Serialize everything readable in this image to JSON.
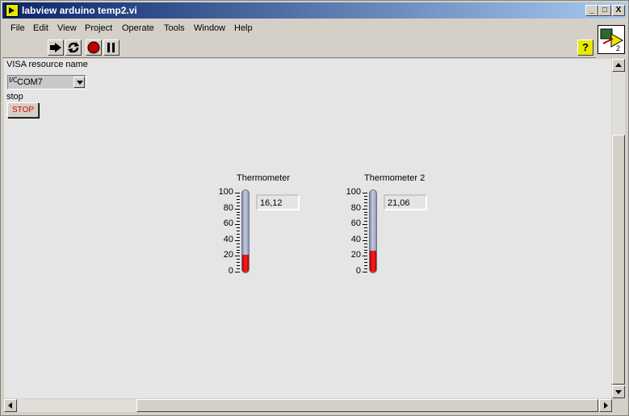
{
  "window": {
    "title": "labview arduino temp2.vi",
    "controls": [
      "_",
      "□",
      "X"
    ]
  },
  "menu": [
    "File",
    "Edit",
    "View",
    "Project",
    "Operate",
    "Tools",
    "Window",
    "Help"
  ],
  "toolbar": {
    "buttons": [
      "run-icon",
      "run-continuously-icon",
      "abort-icon",
      "pause-icon"
    ],
    "help_label": "?",
    "vi_icon_number": "2"
  },
  "panel": {
    "visa_label": "VISA resource name",
    "visa_io_glyph": "I/O",
    "visa_value": "COM7",
    "stop_label": "stop",
    "stop_button_text": "STOP"
  },
  "thermometers": [
    {
      "label": "Thermometer",
      "readout": "16,12",
      "value": 16.12,
      "scale": [
        "100",
        "80",
        "60",
        "40",
        "20",
        "0"
      ],
      "range": [
        0,
        100
      ]
    },
    {
      "label": "Thermometer 2",
      "readout": "21,06",
      "value": 21.06,
      "scale": [
        "100",
        "80",
        "60",
        "40",
        "20",
        "0"
      ],
      "range": [
        0,
        100
      ]
    }
  ],
  "colors": {
    "fill": "#ff2020",
    "stop_text": "#e00000",
    "titlebar": "#0a246a"
  }
}
